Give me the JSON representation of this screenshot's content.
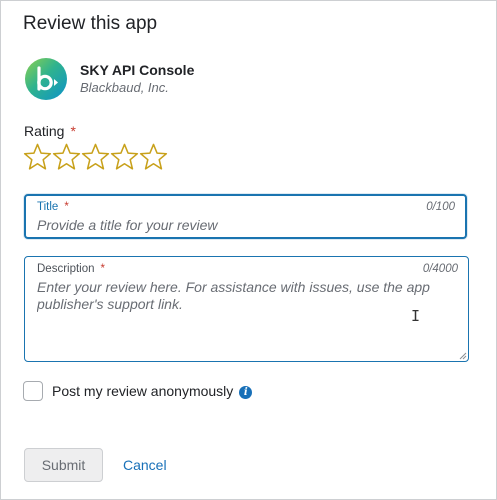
{
  "dialog": {
    "heading": "Review this app"
  },
  "app": {
    "name": "SKY API Console",
    "vendor": "Blackbaud, Inc.",
    "logo_icon": "blackbaud-logo-icon"
  },
  "rating": {
    "label": "Rating",
    "required_mark": "*",
    "max_stars": 5,
    "selected": 0,
    "star_color": "#c8a11b"
  },
  "title_field": {
    "label": "Title",
    "required_mark": "*",
    "counter": "0/100",
    "value": "",
    "placeholder": "Provide a title for your review"
  },
  "description_field": {
    "label": "Description",
    "required_mark": "*",
    "counter": "0/4000",
    "value": "",
    "placeholder": "Enter your review here. For assistance with issues, use the app publisher's support link."
  },
  "anonymous": {
    "label": "Post my review anonymously",
    "checked": false,
    "info_icon": "info-icon"
  },
  "actions": {
    "submit_label": "Submit",
    "cancel_label": "Cancel"
  },
  "colors": {
    "accent": "#1a74b0",
    "required": "#c73a2e",
    "link": "#1870b8"
  }
}
